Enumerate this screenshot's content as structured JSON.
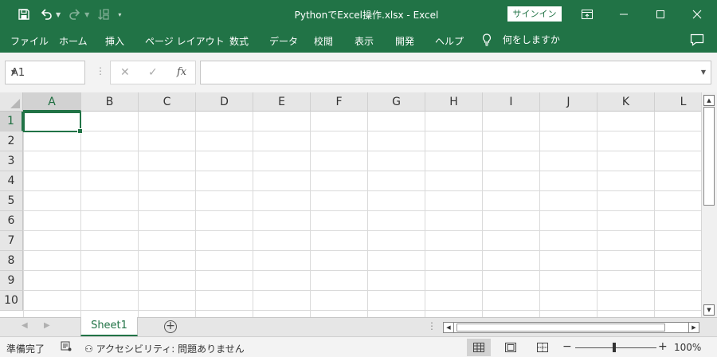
{
  "window": {
    "title": "PythonでExcel操作.xlsx  -  Excel",
    "signin_label": "サインイン"
  },
  "ribbon": {
    "tabs": [
      "ファイル",
      "ホーム",
      "挿入",
      "ページ レイアウト",
      "数式",
      "データ",
      "校閲",
      "表示",
      "開発",
      "ヘルプ"
    ],
    "tell_me": "何をしますか"
  },
  "formula_bar": {
    "name_box": "A1",
    "fx_label": "fx",
    "value": ""
  },
  "grid": {
    "columns": [
      "A",
      "B",
      "C",
      "D",
      "E",
      "F",
      "G",
      "H",
      "I",
      "J",
      "K",
      "L"
    ],
    "rows": [
      "1",
      "2",
      "3",
      "4",
      "5",
      "6",
      "7",
      "8",
      "9",
      "10"
    ],
    "active_cell": "A1"
  },
  "sheets": {
    "tabs": [
      "Sheet1"
    ],
    "active": "Sheet1",
    "add_symbol": "+"
  },
  "status_bar": {
    "ready": "準備完了",
    "accessibility": "アクセシビリティ: 問題ありません",
    "zoom_minus": "−",
    "zoom_plus": "+",
    "zoom": "100%"
  },
  "colors": {
    "accent": "#217346",
    "grid_line": "#dadada",
    "header_bg": "#e6e6e6"
  }
}
